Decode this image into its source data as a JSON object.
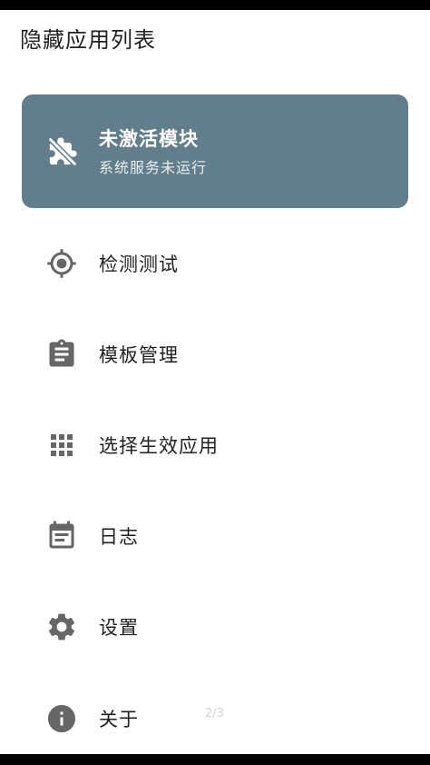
{
  "app": {
    "title": "隐藏应用列表"
  },
  "status_card": {
    "title": "未激活模块",
    "subtitle": "系统服务未运行",
    "icon": "extension-off-icon",
    "background_color": "#627d8b"
  },
  "menu": {
    "items": [
      {
        "label": "检测测试",
        "icon": "gps-target-icon"
      },
      {
        "label": "模板管理",
        "icon": "clipboard-icon"
      },
      {
        "label": "选择生效应用",
        "icon": "apps-grid-icon"
      },
      {
        "label": "日志",
        "icon": "calendar-icon"
      },
      {
        "label": "设置",
        "icon": "gear-icon"
      },
      {
        "label": "关于",
        "icon": "info-icon"
      }
    ]
  },
  "page_indicator": "2/3",
  "colors": {
    "icon": "#666666",
    "text": "#1f1f1f"
  }
}
